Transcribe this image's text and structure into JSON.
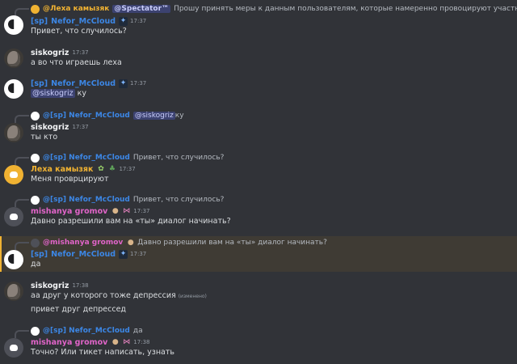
{
  "colors": {
    "bg": "#313338",
    "nefor": "#3c87e6",
    "leha": "#f0b232",
    "mishanya": "#e064c8",
    "white_name": "#f2f3f5",
    "mention_bg": "#3c4270"
  },
  "top_reply": {
    "name": "@Леха камызяк",
    "mention": "@Spectator™",
    "text": "Прошу принять меры к данным пользователям, которые намеренно провоцируют участников в чате. Они использует ..."
  },
  "messages": {
    "m1": {
      "tag": "[sp]",
      "author": "Nefor_McCloud",
      "time": "17:37",
      "text": "Привет, что случилось?"
    },
    "m2": {
      "author": "siskogriz",
      "time": "17:37",
      "text": "а во что играешь леха"
    },
    "m3": {
      "tag": "[sp]",
      "author": "Nefor_McCloud",
      "time": "17:37",
      "mention": "@siskogriz",
      "text": " ку"
    },
    "m4": {
      "reply_name": "@[sp] Nefor_McCloud",
      "reply_mention": "@siskogriz",
      "reply_text": " ку",
      "author": "siskogriz",
      "time": "17:37",
      "text": "ты кто"
    },
    "m5": {
      "reply_name": "@[sp] Nefor_McCloud",
      "reply_text": "Привет, что случилось?",
      "author": "Леха камызяк",
      "time": "17:37",
      "text": "Меня проврцируют"
    },
    "m6": {
      "reply_name": "@[sp] Nefor_McCloud",
      "reply_text": "Привет, что случилось?",
      "author": "mishanya gromov",
      "time": "17:37",
      "text": "Давно разрешили вам на «ты» диалог начинать?"
    },
    "m7": {
      "reply_name": "@mishanya gromov",
      "reply_text": "Давно разрешили вам на «ты» диалог начинать?",
      "tag": "[sp]",
      "author": "Nefor_McCloud",
      "time": "17:37",
      "text": "да"
    },
    "m8": {
      "author": "siskogriz",
      "time": "17:38",
      "text": "аа друг у которого тоже депрессия",
      "edited": "(изменено)",
      "text2": "привет друг депрессед"
    },
    "m9": {
      "reply_name": "@[sp] Nefor_McCloud",
      "reply_text": "да",
      "author": "mishanya gromov",
      "time": "17:38",
      "text": "Точно? Или тикет написать, узнать"
    }
  }
}
